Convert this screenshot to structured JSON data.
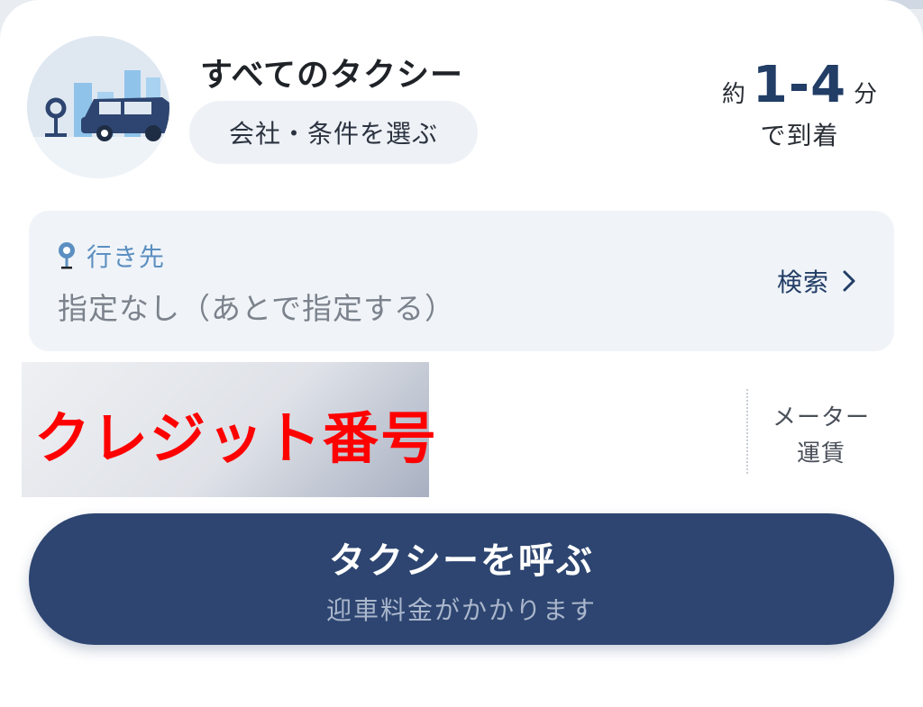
{
  "header": {
    "service_title": "すべてのタクシー",
    "choose_chip_label": "会社・条件を選ぶ",
    "illustration_icon": "taxi-city-illustration"
  },
  "eta": {
    "prefix": "約",
    "value": "1-4",
    "unit": "分",
    "suffix": "で到着"
  },
  "destination": {
    "label": "行き先",
    "value": "指定なし（あとで指定する）",
    "search_label": "検索",
    "icons": [
      "location-pin-icon",
      "chevron-right-icon"
    ]
  },
  "payment": {
    "redaction_text": "クレジット番号"
  },
  "fare": {
    "line1": "メーター",
    "line2": "運賃"
  },
  "call_button": {
    "label": "タクシーを呼ぶ",
    "sublabel": "迎車料金がかかります"
  },
  "colors": {
    "primary": "#2d4570",
    "accent_text": "#223d66",
    "pin_blue": "#5c8fc1",
    "redaction_red": "#ff0000"
  }
}
